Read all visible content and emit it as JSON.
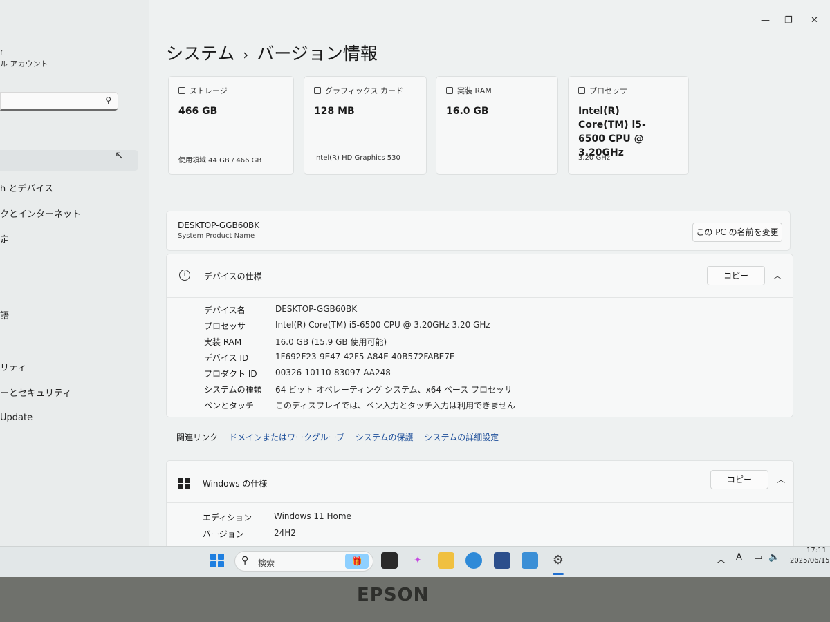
{
  "window": {
    "minimize": "—",
    "maximize": "❐",
    "close": "✕"
  },
  "sidebar": {
    "user_name": "r",
    "user_sub": "ル アカウント",
    "search_icon": "search-icon",
    "items": [
      {
        "label": "h とデバイス"
      },
      {
        "label": "クとインターネット"
      },
      {
        "label": "定"
      },
      {
        "label": "語"
      },
      {
        "label": "リティ"
      },
      {
        "label": "ーとセキュリティ"
      },
      {
        "label": "Update"
      }
    ]
  },
  "breadcrumb": {
    "parent": "システム",
    "separator": "›",
    "current": "バージョン情報"
  },
  "cards": [
    {
      "label": "ストレージ",
      "value": "466 GB",
      "foot": "使用領域 44 GB / 466 GB"
    },
    {
      "label": "グラフィックス カード",
      "value": "128 MB",
      "foot": "Intel(R) HD Graphics 530"
    },
    {
      "label": "実装 RAM",
      "value": "16.0 GB",
      "foot": ""
    },
    {
      "label": "プロセッサ",
      "value": "Intel(R) Core(TM) i5-6500 CPU @ 3.20GHz",
      "foot": "3.20 GHz"
    }
  ],
  "pc": {
    "name": "DESKTOP-GGB60BK",
    "subtitle": "System Product Name",
    "rename_button": "この PC の名前を変更"
  },
  "device_specs": {
    "title": "デバイスの仕様",
    "copy_button": "コピー",
    "rows": [
      {
        "key": "デバイス名",
        "value": "DESKTOP-GGB60BK"
      },
      {
        "key": "プロセッサ",
        "value": "Intel(R) Core(TM) i5-6500 CPU @ 3.20GHz   3.20 GHz"
      },
      {
        "key": "実装 RAM",
        "value": "16.0 GB (15.9 GB 使用可能)"
      },
      {
        "key": "デバイス ID",
        "value": "1F692F23-9E47-42F5-A84E-40B572FABE7E"
      },
      {
        "key": "プロダクト ID",
        "value": "00326-10110-83097-AA248"
      },
      {
        "key": "システムの種類",
        "value": "64 ビット オペレーティング システム、x64 ベース プロセッサ"
      },
      {
        "key": "ペンとタッチ",
        "value": "このディスプレイでは、ペン入力とタッチ入力は利用できません"
      }
    ]
  },
  "related_links": {
    "label": "関連リンク",
    "links": [
      "ドメインまたはワークグループ",
      "システムの保護",
      "システムの詳細設定"
    ]
  },
  "windows_specs": {
    "title": "Windows の仕様",
    "copy_button": "コピー",
    "rows": [
      {
        "key": "エディション",
        "value": "Windows 11 Home"
      },
      {
        "key": "バージョン",
        "value": "24H2"
      }
    ]
  },
  "taskbar": {
    "search_placeholder": "検索",
    "tray_input": "A",
    "time": "17:11",
    "date": "2025/06/15"
  },
  "bezel": {
    "brand": "EPSON"
  }
}
